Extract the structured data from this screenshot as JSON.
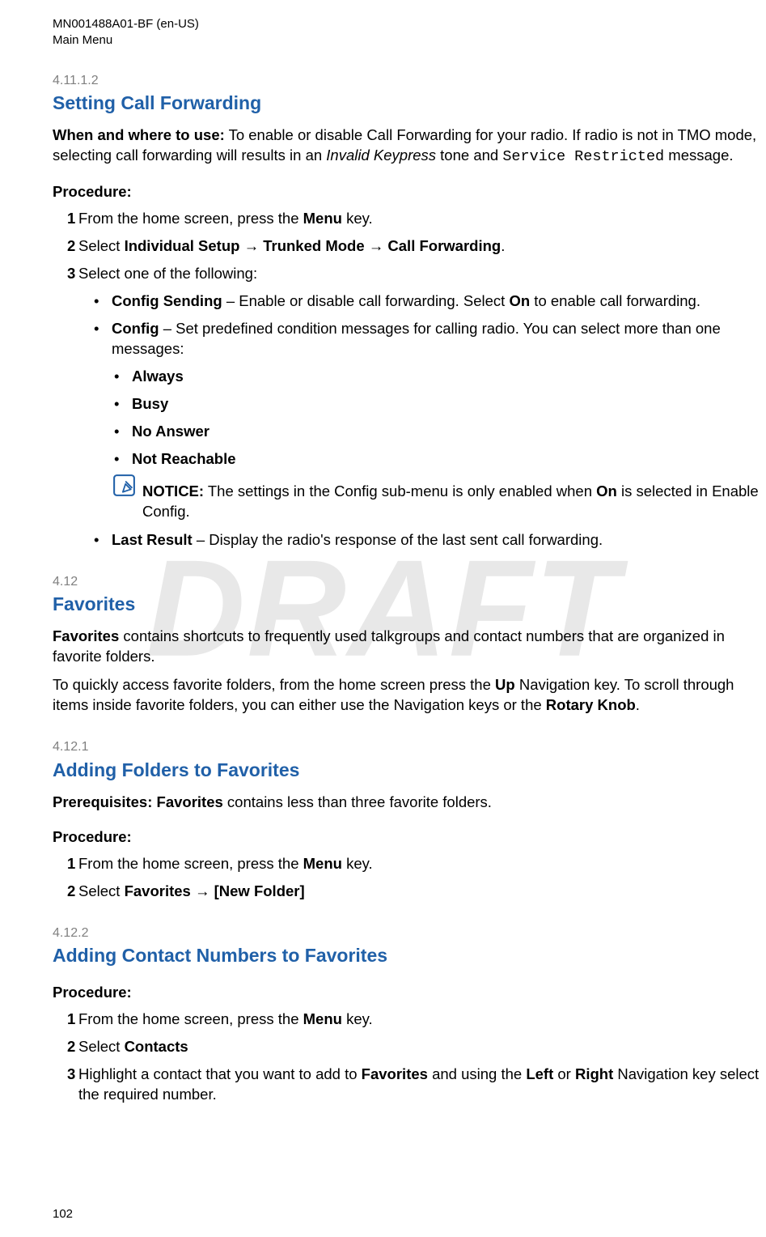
{
  "header": {
    "doc_id": "MN001488A01-BF (en-US)",
    "section_name": "Main Menu"
  },
  "watermark": "DRAFT",
  "page_number": "102",
  "s1": {
    "num": "4.11.1.2",
    "title": "Setting Call Forwarding",
    "when_label": "When and where to use:",
    "when_pre": " To enable or disable Call Forwarding for your radio. If radio is not in TMO mode, selecting call forwarding will results in an ",
    "when_italic": "Invalid Keypress",
    "when_mid": " tone and ",
    "when_mono": "Service Restricted",
    "when_end": " message.",
    "proc_label": "Procedure:",
    "step1_a": "From the home screen, press the ",
    "step1_b": "Menu",
    "step1_c": " key.",
    "step2_a": "Select ",
    "step2_b": "Individual Setup",
    "step2_arrow1": " → ",
    "step2_c": "Trunked Mode",
    "step2_arrow2": " → ",
    "step2_d": "Call Forwarding",
    "step2_e": ".",
    "step3": "Select one of the following:",
    "b1_a": "Config Sending",
    "b1_b": " – Enable or disable call forwarding. Select ",
    "b1_c": "On",
    "b1_d": " to enable call forwarding.",
    "b2_a": "Config",
    "b2_b": " – Set predefined condition messages for calling radio. You can select more than one messages:",
    "sub1": "Always",
    "sub2": "Busy",
    "sub3": "No Answer",
    "sub4": "Not Reachable",
    "notice_label": "NOTICE:",
    "notice_text_a": " The settings in the Config sub-menu is only enabled when ",
    "notice_text_b": "On",
    "notice_text_c": " is selected in Enable Config.",
    "b3_a": "Last Result",
    "b3_b": " – Display the radio's response of the last sent call forwarding."
  },
  "s2": {
    "num": "4.12",
    "title": "Favorites",
    "p1_a": "Favorites",
    "p1_b": " contains shortcuts to frequently used talkgroups and contact numbers that are organized in favorite folders.",
    "p2_a": "To quickly access favorite folders, from the home screen press the ",
    "p2_b": "Up",
    "p2_c": " Navigation key. To scroll through items inside favorite folders, you can either use the Navigation keys or the ",
    "p2_d": "Rotary Knob",
    "p2_e": "."
  },
  "s3": {
    "num": "4.12.1",
    "title": "Adding Folders to Favorites",
    "prereq_label": "Prerequisites: ",
    "prereq_a": "Favorites",
    "prereq_b": " contains less than three favorite folders.",
    "proc_label": "Procedure:",
    "step1_a": "From the home screen, press the ",
    "step1_b": "Menu",
    "step1_c": " key.",
    "step2_a": "Select ",
    "step2_b": "Favorites",
    "step2_arrow": " → ",
    "step2_c": "[New Folder]"
  },
  "s4": {
    "num": "4.12.2",
    "title": "Adding Contact Numbers to Favorites",
    "proc_label": "Procedure:",
    "step1_a": "From the home screen, press the ",
    "step1_b": "Menu",
    "step1_c": " key.",
    "step2_a": "Select ",
    "step2_b": "Contacts",
    "step3_a": "Highlight a contact that you want to add to ",
    "step3_b": "Favorites",
    "step3_c": " and using the ",
    "step3_d": "Left",
    "step3_e": " or ",
    "step3_f": "Right",
    "step3_g": " Navigation key select the required number."
  }
}
